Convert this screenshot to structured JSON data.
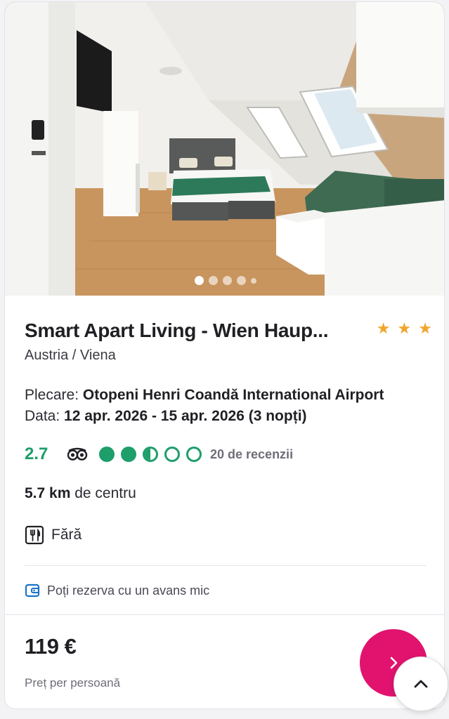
{
  "listing": {
    "name": "Smart Apart Living - Wien Haup...",
    "stars": 3,
    "location": "Austria / Viena",
    "departure_label": "Plecare: ",
    "departure_value": "Otopeni Henri Coandă International Airport",
    "date_label": "Data: ",
    "date_value": "12 apr. 2026 - 15 apr. 2026 (3 nopți)",
    "rating_score": "2.7",
    "rating_bubbles": 2.5,
    "rating_bubbles_max": 5,
    "reviews_text": "20 de recenzii",
    "distance_value": "5.7 km",
    "distance_text": " de centru",
    "meal_text": "Fără",
    "deposit_text": "Poți rezerva cu un avans mic",
    "price": "119 €",
    "price_label": "Preț per persoană"
  },
  "gallery": {
    "total_images": 5,
    "active_index": 0
  },
  "icons": {
    "star": "star-icon",
    "tripadvisor": "tripadvisor-owl-icon",
    "meal": "fork-knife-icon",
    "deposit": "wallet-icon",
    "go": "chevron-right-icon",
    "scroll_top": "chevron-up-icon"
  },
  "colors": {
    "accent": "#e1136f",
    "rating_green": "#1e9e6a",
    "star": "#f2a52b",
    "deposit_blue": "#1a73c9"
  }
}
